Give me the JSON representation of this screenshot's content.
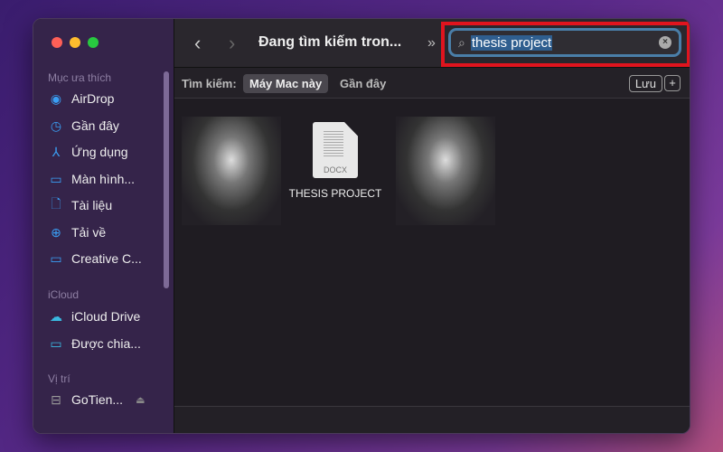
{
  "window": {
    "title": "Đang tìm kiếm tron..."
  },
  "sidebar": {
    "sections": [
      {
        "label": "Mục ưa thích",
        "items": [
          {
            "label": "AirDrop",
            "icon": "airdrop-icon"
          },
          {
            "label": "Gần đây",
            "icon": "clock-icon"
          },
          {
            "label": "Ứng dụng",
            "icon": "apps-icon"
          },
          {
            "label": "Màn hình...",
            "icon": "desktop-icon"
          },
          {
            "label": "Tài liệu",
            "icon": "document-icon"
          },
          {
            "label": "Tải về",
            "icon": "download-icon"
          },
          {
            "label": "Creative C...",
            "icon": "folder-icon"
          }
        ]
      },
      {
        "label": "iCloud",
        "items": [
          {
            "label": "iCloud Drive",
            "icon": "cloud-icon"
          },
          {
            "label": "Được chia...",
            "icon": "shared-folder-icon"
          }
        ]
      },
      {
        "label": "Vị trí",
        "items": [
          {
            "label": "GoTien...",
            "icon": "drive-icon"
          }
        ]
      }
    ]
  },
  "search": {
    "value": "thesis project"
  },
  "filter": {
    "label": "Tìm kiếm:",
    "selected": "Máy Mac này",
    "other": "Gần đây",
    "save": "Lưu",
    "add": "+"
  },
  "files": [
    {
      "name": "THESIS PROJECT",
      "type": "DOCX"
    }
  ],
  "colors": {
    "highlight": "#e0141e",
    "accent": "#3a9ff5"
  }
}
